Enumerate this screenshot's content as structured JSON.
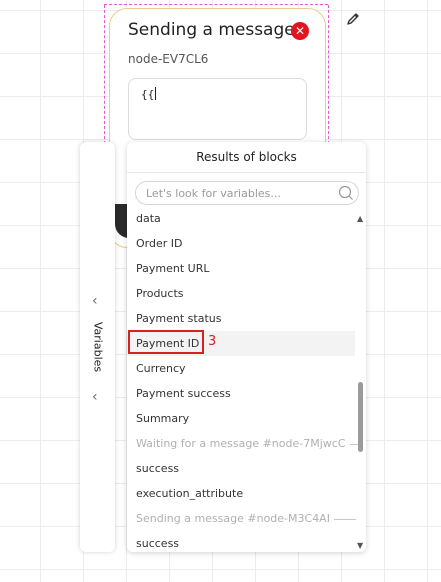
{
  "node": {
    "title": "Sending a message",
    "id": "node-EV7CL6",
    "textarea_value": "{{"
  },
  "side_panel": {
    "label": "Variables"
  },
  "results": {
    "header": "Results of blocks",
    "search_placeholder": "Let's look for variables...",
    "items": [
      {
        "label": "data"
      },
      {
        "label": "Order ID"
      },
      {
        "label": "Payment URL"
      },
      {
        "label": "Products"
      },
      {
        "label": "Payment status"
      },
      {
        "label": "Payment ID"
      },
      {
        "label": "Currency"
      },
      {
        "label": "Payment success"
      },
      {
        "label": "Summary"
      },
      {
        "label": "Waiting for a message #node-7MjwcC"
      },
      {
        "label": "success"
      },
      {
        "label": "execution_attribute"
      },
      {
        "label": "Sending a message #node-M3C4AI"
      },
      {
        "label": "success"
      }
    ]
  },
  "annotation": {
    "number": "3"
  },
  "colors": {
    "close": "#e3141d",
    "annotation": "#d32222",
    "node_border": "#f1c98c"
  }
}
